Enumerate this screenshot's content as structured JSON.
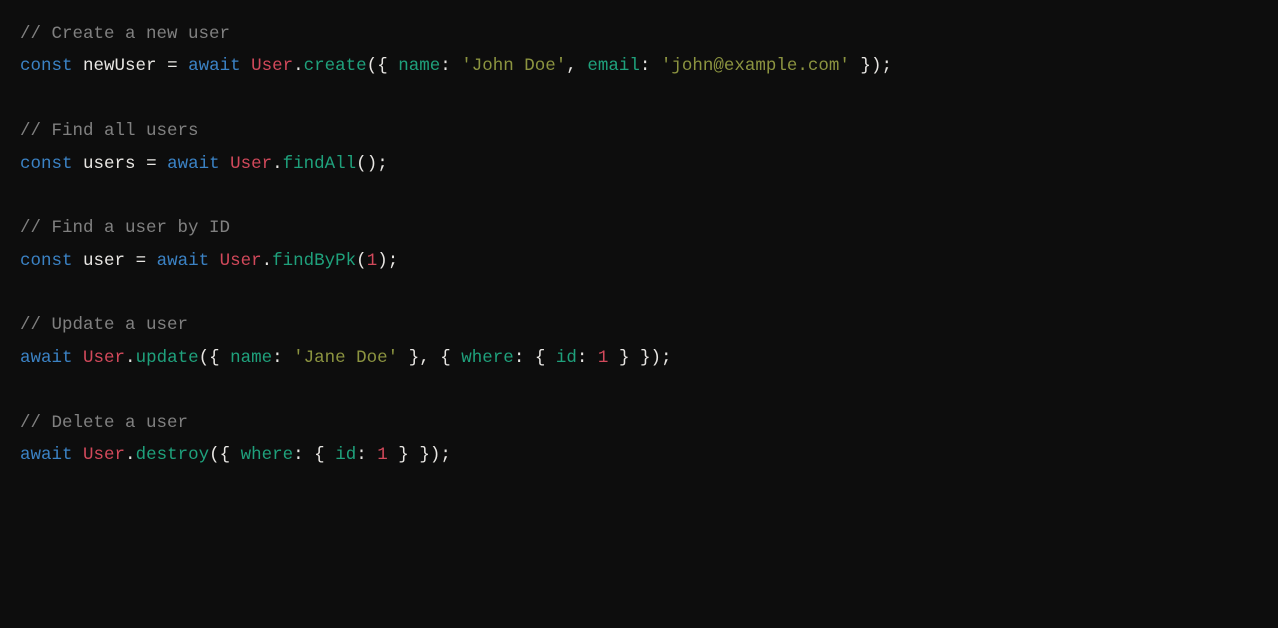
{
  "code": {
    "comments": {
      "create": "// Create a new user",
      "findAll": "// Find all users",
      "findById": "// Find a user by ID",
      "update": "// Update a user",
      "delete": "// Delete a user"
    },
    "keywords": {
      "const": "const",
      "await": "await"
    },
    "identifiers": {
      "newUser": "newUser",
      "users": "users",
      "user": "user",
      "User": "User"
    },
    "methods": {
      "create": "create",
      "findAll": "findAll",
      "findByPk": "findByPk",
      "update": "update",
      "destroy": "destroy"
    },
    "props": {
      "name": "name",
      "email": "email",
      "where": "where",
      "id": "id"
    },
    "strings": {
      "johnDoe": "'John Doe'",
      "johnEmail": "'john@example.com'",
      "janeDoe": "'Jane Doe'"
    },
    "numbers": {
      "one": "1"
    },
    "punct": {
      "dot": ".",
      "comma": ",",
      "colon": ":",
      "semi": ";",
      "eq": "=",
      "lp": "(",
      "rp": ")",
      "lb": "{",
      "rb": "}",
      "sp": " "
    }
  }
}
